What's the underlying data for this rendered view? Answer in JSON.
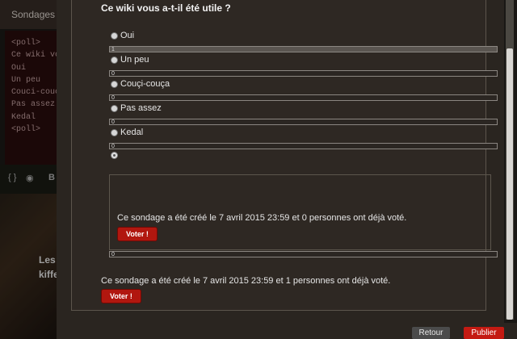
{
  "background": {
    "header_title": "Sondages",
    "code_lines": [
      "<poll>",
      "Ce wiki vo",
      "Oui",
      "Un peu",
      "Couci-couç",
      "Pas assez",
      "Kedal",
      "<poll>"
    ],
    "toolbar": {
      "code_glyph": "{ }",
      "eye_glyph": "◉",
      "bold_label": "B"
    },
    "side_text": [
      "Les",
      "kiffe"
    ]
  },
  "poll": {
    "question": "Ce wiki vous a-t-il été utile ?",
    "options": [
      {
        "label": "Oui",
        "votes": "1",
        "fraction": 1.0
      },
      {
        "label": "Un peu",
        "votes": "0",
        "fraction": 0
      },
      {
        "label": "Couçi-couça",
        "votes": "0",
        "fraction": 0
      },
      {
        "label": "Pas assez",
        "votes": "0",
        "fraction": 0
      },
      {
        "label": "Kedal",
        "votes": "0",
        "fraction": 0
      }
    ],
    "extra_option_votes": "0",
    "inner_created_text": "Ce sondage a été créé le 7 avril 2015 23:59 et 0 personnes ont déjà voté.",
    "inner_vote_label": "Voter !",
    "outer_created_text": "Ce sondage a été créé le 7 avril 2015 23:59 et 1 personnes ont déjà voté.",
    "outer_vote_label": "Voter !"
  },
  "footer": {
    "retour_label": "Retour",
    "publier_label": "Publier"
  }
}
